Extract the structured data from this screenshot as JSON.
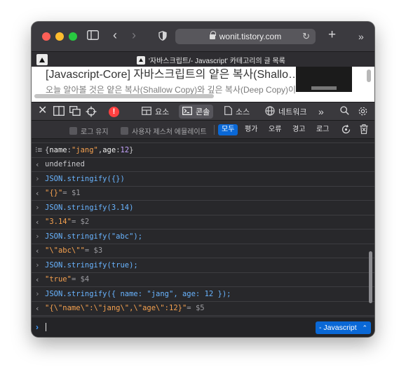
{
  "browser": {
    "url": "wonit.tistory.com"
  },
  "tab": {
    "title": "'자바스크립트/- Javascript' 카테고리의 글 목록"
  },
  "page_preview": {
    "title": "[Javascript-Core] 자바스크립트의 얕은 복사(Shallo…",
    "snippet": "오늘 알아볼 것은 얕은 복사(Shallow Copy)와 깊은 복사(Deep Copy)이"
  },
  "devtools": {
    "tabs": {
      "elements": "요소",
      "console": "콘솔",
      "sources": "소스",
      "network": "네트워크"
    },
    "filters": {
      "preserve_log": "로그 유지",
      "user_suggestions": "사용자 제스처 에뮬레이트",
      "all": "모두",
      "evaluations": "평가",
      "errors": "오류",
      "warnings": "경고",
      "logs": "로그"
    }
  },
  "console": {
    "rows": [
      {
        "type": "obj",
        "marker": "⁝≡",
        "text": ""
      },
      {
        "type": "out",
        "text": "undefined"
      },
      {
        "type": "in",
        "text": "JSON.stringify({})"
      },
      {
        "type": "out",
        "value": "\"{}\"",
        "var": " = $1"
      },
      {
        "type": "in",
        "text": "JSON.stringify(3.14)"
      },
      {
        "type": "out",
        "value": "\"3.14\"",
        "var": " = $2"
      },
      {
        "type": "in",
        "text": "JSON.stringify(\"abc\");"
      },
      {
        "type": "out",
        "value": "\"\\\"abc\\\"\"",
        "var": " = $3"
      },
      {
        "type": "in",
        "text": "JSON.stringify(true);"
      },
      {
        "type": "out",
        "value": "\"true\"",
        "var": " = $4"
      },
      {
        "type": "in",
        "text": "JSON.stringify({ name: \"jang\", age: 12 });"
      },
      {
        "type": "out",
        "value": "\"{\\\"name\\\":\\\"jang\\\",\\\"age\\\":12}\"",
        "var": " = $5"
      }
    ],
    "object_row": {
      "open": "{",
      "k1": "name",
      "v1": "\"jang\"",
      "k2": "age",
      "v2": "12",
      "close": "}"
    },
    "context": "- Javascript"
  }
}
